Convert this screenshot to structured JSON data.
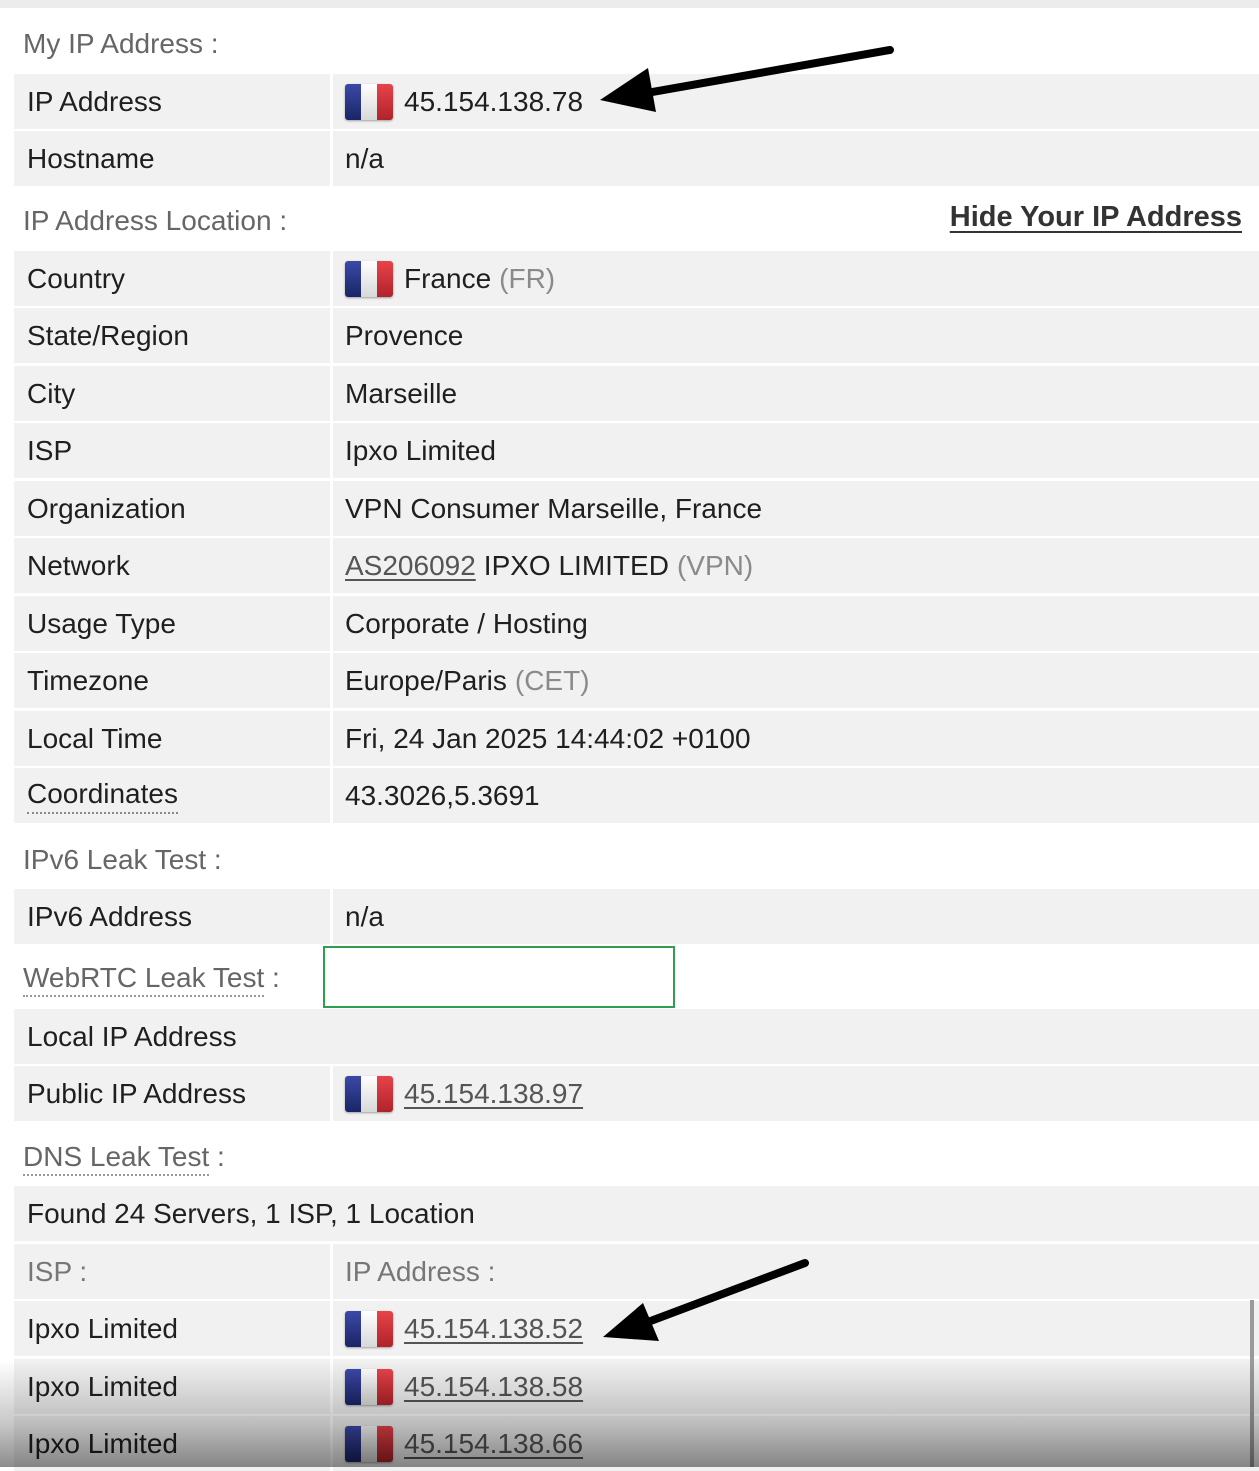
{
  "sections": {
    "my_ip": "My IP Address :",
    "location": "IP Address Location :",
    "hide_link": "Hide Your IP Address",
    "ipv6": "IPv6 Leak Test :",
    "webrtc": "WebRTC Leak Test",
    "webrtc_suffix": " :",
    "dns": "DNS Leak Test",
    "dns_suffix": " :"
  },
  "my_ip": {
    "ip_label": "IP Address",
    "ip_value": "45.154.138.78",
    "hostname_label": "Hostname",
    "hostname_value": "n/a"
  },
  "location": {
    "country_label": "Country",
    "country_value": "France",
    "country_code": "(FR)",
    "region_label": "State/Region",
    "region_value": "Provence",
    "city_label": "City",
    "city_value": "Marseille",
    "isp_label": "ISP",
    "isp_value": "Ipxo Limited",
    "org_label": "Organization",
    "org_value": "VPN Consumer Marseille, France",
    "network_label": "Network",
    "network_asn": "AS206092",
    "network_name": "IPXO LIMITED",
    "network_tag": "(VPN)",
    "usage_label": "Usage Type",
    "usage_value": "Corporate / Hosting",
    "tz_label": "Timezone",
    "tz_value": "Europe/Paris",
    "tz_abbr": "(CET)",
    "time_label": "Local Time",
    "time_value": "Fri, 24 Jan 2025 14:44:02 +0100",
    "coord_label": "Coordinates",
    "coord_value": "43.3026,5.3691"
  },
  "ipv6": {
    "label": "IPv6 Address",
    "value": "n/a"
  },
  "webrtc": {
    "local_label": "Local IP Address",
    "public_label": "Public IP Address",
    "public_value": "45.154.138.97"
  },
  "dns": {
    "summary": "Found 24 Servers, 1 ISP, 1 Location",
    "col_isp": "ISP :",
    "col_ip": "IP Address :",
    "rows": [
      {
        "isp": "Ipxo Limited",
        "ip": "45.154.138.52"
      },
      {
        "isp": "Ipxo Limited",
        "ip": "45.154.138.58"
      },
      {
        "isp": "Ipxo Limited",
        "ip": "45.154.138.66"
      }
    ]
  },
  "icons": {
    "flag": "france-flag-icon",
    "arrow": "annotation-arrow-icon"
  },
  "colors": {
    "row_bg": "#f1f1f1",
    "label_gray": "#666666",
    "green_box": "#2f9e4f"
  }
}
